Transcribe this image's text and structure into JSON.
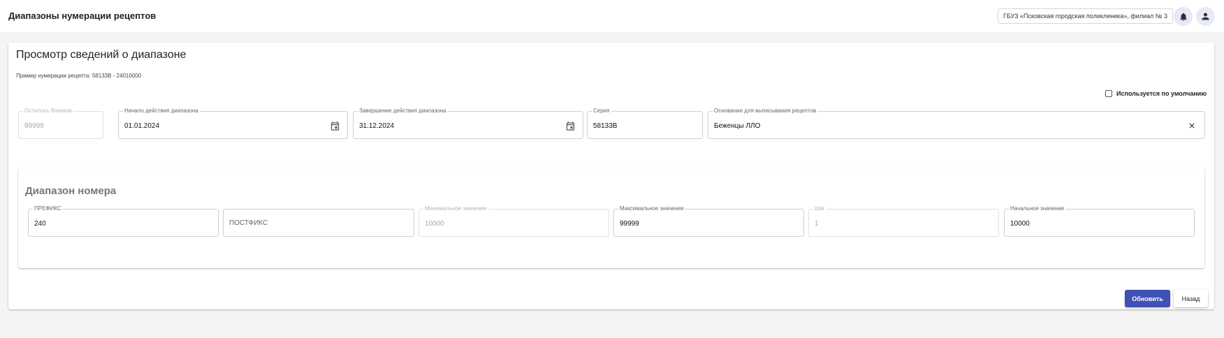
{
  "header": {
    "title": "Диапазоны нумерации рецептов",
    "organization": "ГБУЗ «Псковская городская поликлиника», филиал № 3",
    "bell_icon": "bell-icon",
    "user_icon": "account-icon"
  },
  "card": {
    "title": "Просмотр сведений о диапазоне",
    "example": "Пример нумерации рецепта: 58133В - 24010000",
    "default_checkbox": {
      "label": "Используется по умолчанию",
      "checked": false
    }
  },
  "fields": {
    "remaining": {
      "label": "Осталось бланков",
      "value": "89999"
    },
    "start_date": {
      "label": "Начало действия диапазона",
      "value": "01.01.2024"
    },
    "end_date": {
      "label": "Завершение действия диапазона",
      "value": "31.12.2024"
    },
    "series": {
      "label": "Серия",
      "value": "58133В"
    },
    "basis": {
      "label": "Основание для выписывания рецептов",
      "value": "Беженцы ЛЛО"
    }
  },
  "range": {
    "title": "Диапазон номера",
    "prefix": {
      "label": "ПРЕФИКС",
      "value": "240"
    },
    "postfix": {
      "placeholder": "ПОСТФИКС"
    },
    "min": {
      "label": "Минимальное значение",
      "value": "10000"
    },
    "max": {
      "label": "Максимальное значение",
      "value": "99999"
    },
    "step": {
      "label": "Шаг",
      "value": "1"
    },
    "initial": {
      "label": "Начальное значение",
      "value": "10000"
    }
  },
  "buttons": {
    "update": "Обновить",
    "back": "Назад"
  },
  "colors": {
    "primary": "#3f51b5",
    "icon_bg": "#e7e9f3",
    "icon": "#2a2d4a"
  }
}
